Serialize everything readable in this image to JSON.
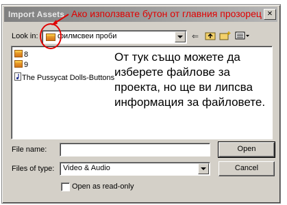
{
  "window": {
    "title": "Import Assets",
    "close_glyph": "✕"
  },
  "annotation": {
    "text": "Ако използвате бутон от главния прозорец",
    "color": "#e00000"
  },
  "lookin": {
    "label": "Look in:",
    "value": "филмсвеи проби"
  },
  "files": [
    {
      "name": "8",
      "icon": "folder-icon"
    },
    {
      "name": "9",
      "icon": "folder-icon"
    },
    {
      "name": "The Pussycat Dolls-Buttons",
      "icon": "music-file-icon"
    }
  ],
  "note": "От тук също можете да изберете файлове за проекта, но ще ви липсва информация за файловете.",
  "filename": {
    "label": "File name:",
    "value": ""
  },
  "filetype": {
    "label": "Files of type:",
    "value": "Video & Audio"
  },
  "buttons": {
    "open": "Open",
    "cancel": "Cancel"
  },
  "readonly": {
    "label": "Open as read-only",
    "checked": false
  }
}
